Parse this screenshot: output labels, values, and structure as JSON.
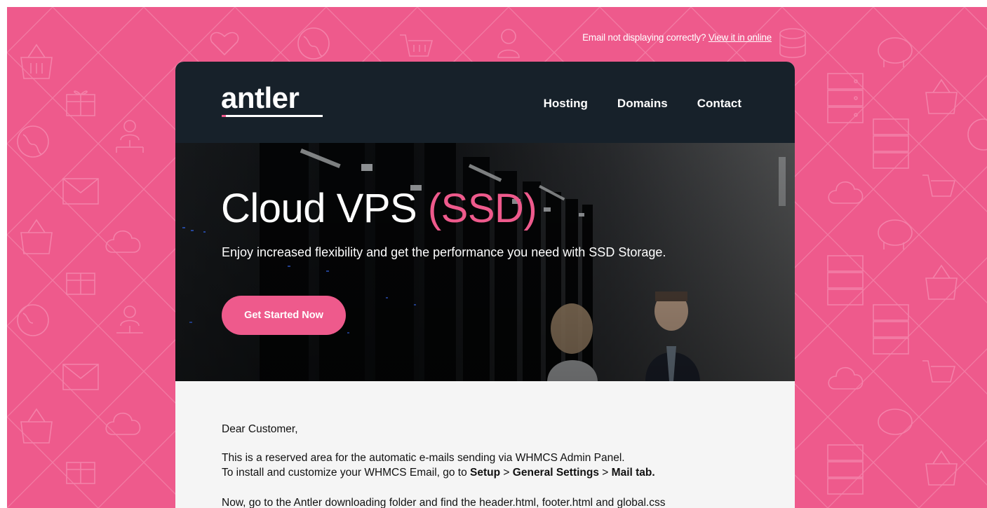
{
  "preheader": {
    "text": "Email not displaying correctly?",
    "link": "View it in online"
  },
  "header": {
    "logo": "antler",
    "nav": [
      "Hosting",
      "Domains",
      "Contact"
    ]
  },
  "hero": {
    "title_main": "Cloud VPS",
    "title_accent": "(SSD)",
    "subtitle": "Enjoy increased flexibility and get the performance you need with SSD Storage.",
    "cta": "Get Started Now"
  },
  "content": {
    "greeting": "Dear Customer,",
    "line1": "This is a reserved area for the automatic e-mails sending via WHMCS Admin Panel.",
    "line2_prefix": "To install and customize your WHMCS Email, go to",
    "path_1": "Setup",
    "path_sep": ">",
    "path_2": "General Settings",
    "path_3": "Mail tab.",
    "line3": "Now, go to the Antler downloading folder and find the header.html, footer.html and global.css"
  },
  "colors": {
    "background": "#ee5a8c",
    "header": "#17212a",
    "accent": "#ee5a8c",
    "body_bg": "#f5f5f5"
  },
  "icons": [
    "basket-icon",
    "gift-icon",
    "heart-icon",
    "globe-icon",
    "person-icon",
    "cloud-icon",
    "server-icon",
    "database-icon",
    "envelope-icon",
    "cart-icon",
    "piggy-bank-icon",
    "network-user-icon"
  ]
}
